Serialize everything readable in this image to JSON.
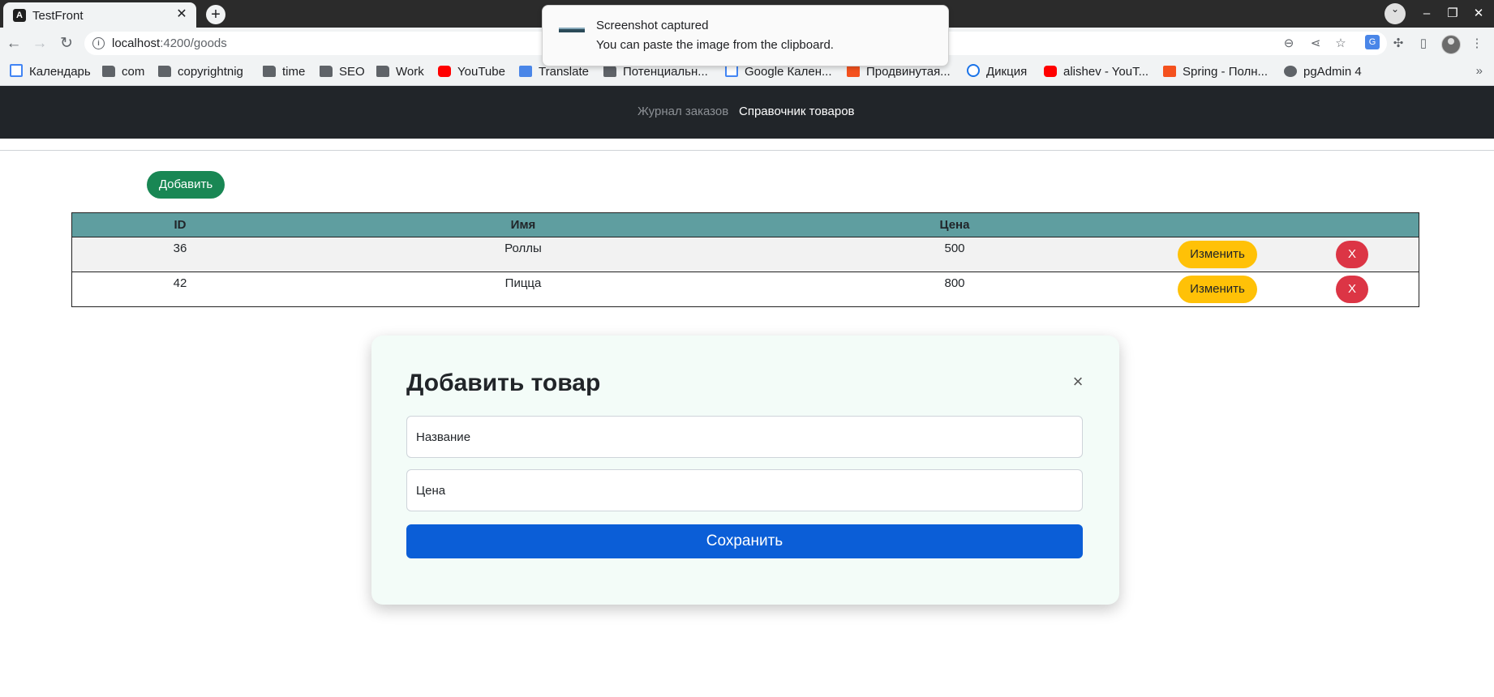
{
  "browser": {
    "tab_title": "TestFront",
    "tab_favicon": "A",
    "url_host": "localhost",
    "url_path": ":4200/goods",
    "bookmarks": [
      {
        "label": "Календарь",
        "icon": "calendar-icon"
      },
      {
        "label": "com",
        "icon": "folder-icon"
      },
      {
        "label": "copyrightnig",
        "icon": "folder-icon"
      },
      {
        "label": "time",
        "icon": "folder-icon"
      },
      {
        "label": "SEO",
        "icon": "folder-icon"
      },
      {
        "label": "Work",
        "icon": "folder-icon"
      },
      {
        "label": "YouTube",
        "icon": "youtube-icon"
      },
      {
        "label": "Translate",
        "icon": "translate-icon"
      },
      {
        "label": "Потенциальн...",
        "icon": "folder-icon"
      },
      {
        "label": "Google Кален...",
        "icon": "calendar-icon"
      },
      {
        "label": "Продвинутая...",
        "icon": "site-icon"
      },
      {
        "label": "Дикция",
        "icon": "site-icon"
      },
      {
        "label": "alishev - YouT...",
        "icon": "youtube-icon"
      },
      {
        "label": "Spring - Полн...",
        "icon": "site-icon"
      },
      {
        "label": "pgAdmin 4",
        "icon": "globe-icon"
      }
    ]
  },
  "notification": {
    "title": "Screenshot captured",
    "body": "You can paste the image from the clipboard."
  },
  "navbar": {
    "links": [
      {
        "label": "Журнал заказов"
      },
      {
        "label": "Справочник товаров"
      }
    ]
  },
  "page": {
    "add_label": "Добавить"
  },
  "table": {
    "headers": [
      "ID",
      "Имя",
      "Цена"
    ],
    "rows": [
      {
        "id": "36",
        "name": "Роллы",
        "price": "500",
        "edit": "Изменить",
        "delete": "X"
      },
      {
        "id": "42",
        "name": "Пицца",
        "price": "800",
        "edit": "Изменить",
        "delete": "X"
      }
    ]
  },
  "modal": {
    "title": "Добавить товар",
    "close": "×",
    "name_placeholder": "Название",
    "price_placeholder": "Цена",
    "save_label": "Сохранить"
  },
  "colors": {
    "navbar_bg": "#212529",
    "add_button": "#198754",
    "table_header": "#5f9ea0",
    "edit_button": "#ffc107",
    "delete_button": "#dc3545",
    "save_button": "#0b5ed7",
    "modal_bg": "#f3fcf8"
  }
}
